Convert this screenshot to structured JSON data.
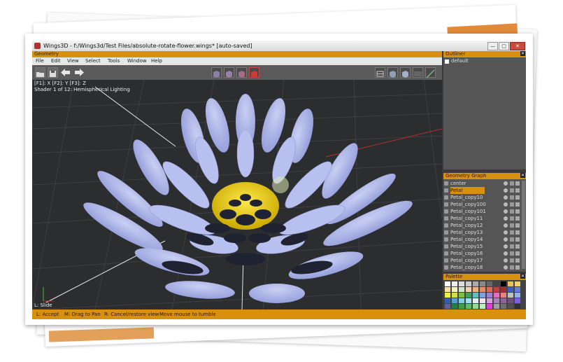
{
  "window": {
    "title": "Wings3D - f:/Wings3d/Test Files/absolute-rotate-flower.wings* [auto-saved]",
    "minimize": "—",
    "maximize": "□",
    "close": "✕"
  },
  "geometry_panel": {
    "title": "Geometry",
    "close_label": "✕"
  },
  "menu": {
    "items": [
      "File",
      "Edit",
      "View",
      "Select",
      "Tools",
      "Window",
      "Help"
    ]
  },
  "toolbar": {
    "left_icons": [
      "open-icon",
      "save-icon",
      "undo-arrow-icon",
      "redo-arrow-icon"
    ],
    "mode_icons": [
      "vertex-mode-icon",
      "edge-mode-icon",
      "face-mode-icon",
      "body-mode-icon"
    ],
    "view_icons": [
      "wireframe-icon",
      "shaded-icon",
      "smooth-icon",
      "groundplane-icon",
      "perspective-icon"
    ]
  },
  "viewport": {
    "axis_hint": "[F1]: X    [F2]: Y    [F3]: Z",
    "shader": "Shader 1 of 12: Hemispherical Lighting",
    "bottom_hint": "L: Slide"
  },
  "statusbar": {
    "accept": "L: Accept",
    "drag": "M: Drag to Pan",
    "cancel": "R: Cancel/restore view",
    "move": "Move mouse to tumble"
  },
  "outliner": {
    "title": "Outliner",
    "items": [
      "default"
    ]
  },
  "geometry_graph": {
    "title": "Geometry Graph",
    "items": [
      "center",
      "Petal",
      "Petal_copy10",
      "Petal_copy100",
      "Petal_copy101",
      "Petal_copy11",
      "Petal_copy12",
      "Petal_copy13",
      "Petal_copy14",
      "Petal_copy15",
      "Petal_copy16",
      "Petal_copy17",
      "Petal_copy18"
    ],
    "selected": "Petal"
  },
  "palette": {
    "title": "Palette",
    "colors": [
      "#ffffff",
      "#eeeeee",
      "#dddddd",
      "#cccccc",
      "#aaaaaa",
      "#888888",
      "#666666",
      "#444444",
      "#000000",
      "#e8c060",
      "#f0d070",
      "#f8e0a0",
      "#f8f0c0",
      "#c8e8c8",
      "#f8d0b0",
      "#f0b080",
      "#e09060",
      "#d07050",
      "#c04040",
      "#a03030",
      "#4060c0",
      "#6080d0",
      "#f0f040",
      "#d0e040",
      "#80c040",
      "#40a060",
      "#60c0c0",
      "#80a0e0",
      "#a080d0",
      "#e070c0",
      "#f08080",
      "#c0c0c0",
      "#90b0f0",
      "#3060b0",
      "#50a0d0",
      "#80d0e0",
      "#a0e0f0",
      "#e0f0f8",
      "#f0e0f0",
      "#d0a0e0",
      "#b080c0",
      "#9060a0",
      "#705080",
      "#8060e0",
      "#6060a0",
      "#208040",
      "#40a040",
      "#60c060",
      "#90e090",
      "#c0f0c0",
      "#e040e0",
      "#a0a0a0",
      "#707070",
      "#505050",
      "#303030"
    ]
  }
}
